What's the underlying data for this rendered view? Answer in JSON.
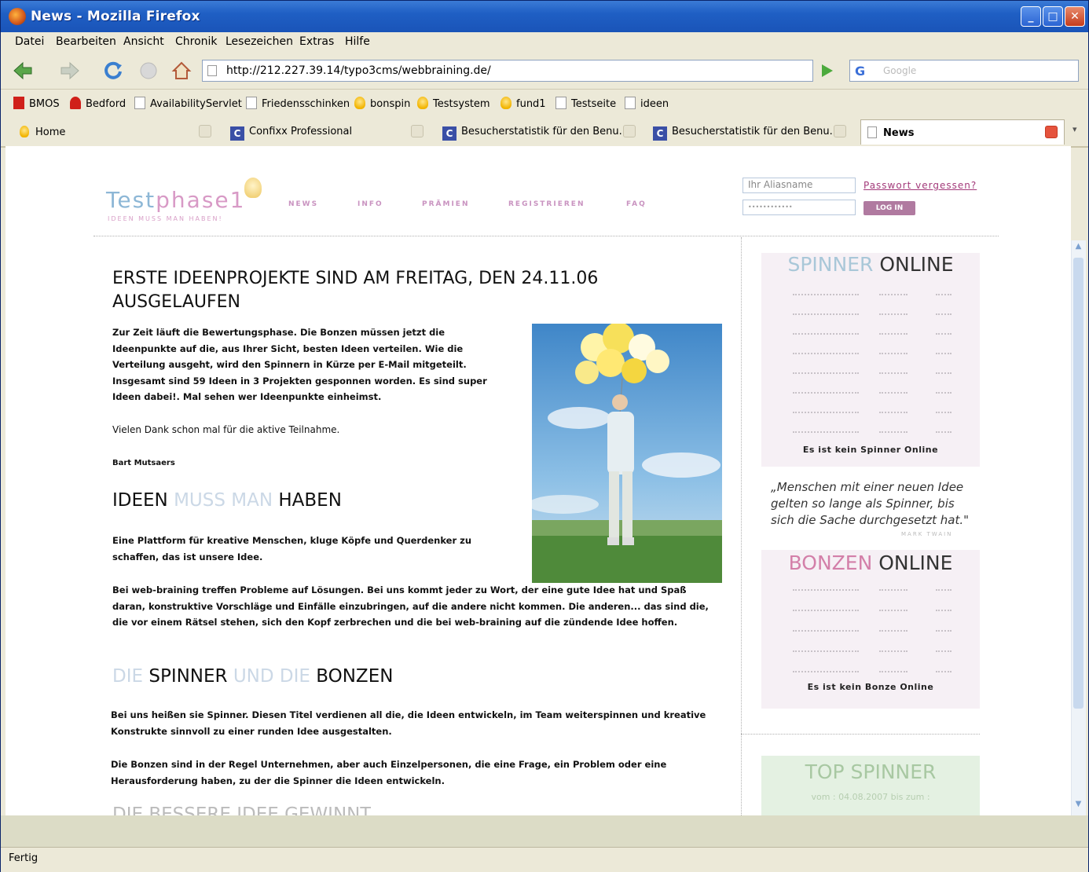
{
  "window": {
    "title": "News - Mozilla Firefox"
  },
  "menu": [
    "Datei",
    "Bearbeiten",
    "Ansicht",
    "Chronik",
    "Lesezeichen",
    "Extras",
    "Hilfe"
  ],
  "address": {
    "url": "http://212.227.39.14/typo3cms/webbraining.de/"
  },
  "search": {
    "placeholder": "Google"
  },
  "bookmarks": [
    "BMOS",
    "Bedford",
    "AvailabilityServlet",
    "Friedensschinken",
    "bonspin",
    "Testsystem",
    "fund1",
    "Testseite",
    "ideen"
  ],
  "tabs": [
    "Home",
    "Confixx Professional",
    "Besucherstatistik für den Benu...",
    "Besucherstatistik für den Benu...",
    "News"
  ],
  "status": {
    "text": "Fertig"
  },
  "site": {
    "logo_a": "Test",
    "logo_b": "phase1",
    "logo_sub": "IDEEN MUSS MAN HABEN!",
    "nav": [
      "NEWS",
      "INFO",
      "PRÄMIEN",
      "REGISTRIEREN",
      "FAQ"
    ],
    "login": {
      "alias_placeholder": "Ihr Aliasname",
      "password_mask": "••••••••••••",
      "forgot": "Passwort vergessen?",
      "button": "LOG IN"
    }
  },
  "article": {
    "headline": "ERSTE IDEENPROJEKTE SIND AM FREITAG, DEN 24.11.06 AUSGELAUFEN",
    "p1": "Zur Zeit läuft die Bewertungsphase. Die Bonzen müssen jetzt die Ideenpunkte auf die, aus Ihrer Sicht, besten Ideen verteilen. Wie die Verteilung ausgeht, wird den Spinnern in Kürze per E-Mail mitgeteilt. Insgesamt sind 59 Ideen in 3 Projekten gesponnen worden. Es sind super Ideen dabei!. Mal sehen wer Ideenpunkte einheimst.",
    "p2": "Vielen Dank schon mal für die aktive Teilnahme.",
    "author": "Bart Mutsaers",
    "h_ideen": {
      "a": "IDEEN",
      "b": "MUSS MAN",
      "c": "HABEN"
    },
    "p3": "Eine Plattform für kreative Menschen, kluge Köpfe und Querdenker zu schaffen, das ist unsere Idee.",
    "p4": "Bei web-braining treffen Probleme auf Lösungen. Bei uns kommt jeder zu Wort, der eine gute Idee hat und Spaß daran, konstruktive Vorschläge und Einfälle einzubringen, auf die andere nicht kommen. Die anderen... das sind die, die vor einem Rätsel stehen, sich den Kopf zerbrechen und die bei web-braining auf die zündende Idee hoffen.",
    "h_spinner": {
      "a": "DIE",
      "b": "SPINNER",
      "c": "UND DIE",
      "d": "BONZEN"
    },
    "p5": "Bei uns heißen sie Spinner. Diesen Titel verdienen all die, die Ideen entwickeln, im Team weiterspinnen und kreative Konstrukte sinnvoll zu einer runden Idee ausgestalten.",
    "p6": "Die Bonzen sind in der Regel Unternehmen, aber auch Einzelpersonen, die eine Frage, ein Problem oder eine Herausforderung haben, zu der die Spinner die Ideen entwickeln.",
    "h_cut": "DIE BESSERE IDEE GEWINNT"
  },
  "sidebar": {
    "spinner": {
      "a": "SPINNER",
      "b": "ONLINE",
      "note": "Es ist kein Spinner Online"
    },
    "quote": "„Menschen mit einer neuen Idee gelten so lange als Spinner, bis sich die Sache durchgesetzt hat.\"",
    "quote_author": "MARK TWAIN",
    "bonzen": {
      "a": "BONZEN",
      "b": "ONLINE",
      "note": "Es ist kein Bonze Online"
    },
    "top": {
      "title": "TOP SPINNER",
      "sub": "vom : 04.08.2007 bis zum :"
    }
  },
  "colors": {
    "titlebar": "#2b64d3",
    "accent_pink": "#d37fa9",
    "accent_blue": "#8db7d6"
  }
}
